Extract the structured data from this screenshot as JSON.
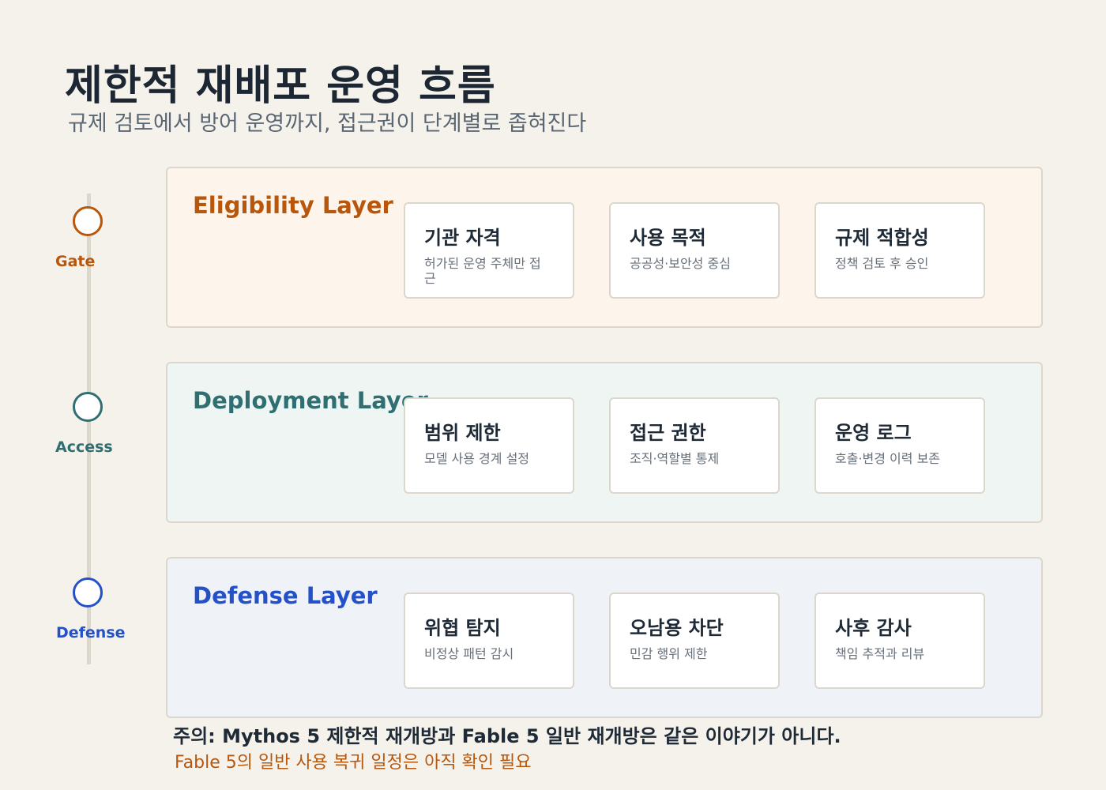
{
  "title": "제한적 재배포 운영 흐름",
  "subtitle": "규제 검토에서 방어 운영까지, 접근권이 단계별로 좁혀진다",
  "colors": {
    "background": "#f5f2ec",
    "eligibility_accent": "#b8570c",
    "deployment_accent": "#2f6f72",
    "defense_accent": "#2450c8",
    "note_accent": "#b8570c"
  },
  "timeline": {
    "nodes": [
      {
        "label": "Gate"
      },
      {
        "label": "Access"
      },
      {
        "label": "Defense"
      }
    ]
  },
  "layers": [
    {
      "title": "Eligibility Layer",
      "cards": [
        {
          "title": "기관 자격",
          "desc": "허가된 운영 주체만 접근"
        },
        {
          "title": "사용 목적",
          "desc": "공공성·보안성 중심"
        },
        {
          "title": "규제 적합성",
          "desc": "정책 검토 후 승인"
        }
      ]
    },
    {
      "title": "Deployment Layer",
      "cards": [
        {
          "title": "범위 제한",
          "desc": "모델 사용 경계 설정"
        },
        {
          "title": "접근 권한",
          "desc": "조직·역할별 통제"
        },
        {
          "title": "운영 로그",
          "desc": "호출·변경 이력 보존"
        }
      ]
    },
    {
      "title": "Defense Layer",
      "cards": [
        {
          "title": "위협 탐지",
          "desc": "비정상 패턴 감시"
        },
        {
          "title": "오남용 차단",
          "desc": "민감 행위 제한"
        },
        {
          "title": "사후 감사",
          "desc": "책임 추적과 리뷰"
        }
      ]
    }
  ],
  "note": {
    "main": "주의: Mythos 5 제한적 재개방과 Fable 5 일반 재개방은 같은 이야기가 아니다.",
    "sub": "Fable 5의 일반 사용 복귀 일정은 아직 확인 필요"
  }
}
